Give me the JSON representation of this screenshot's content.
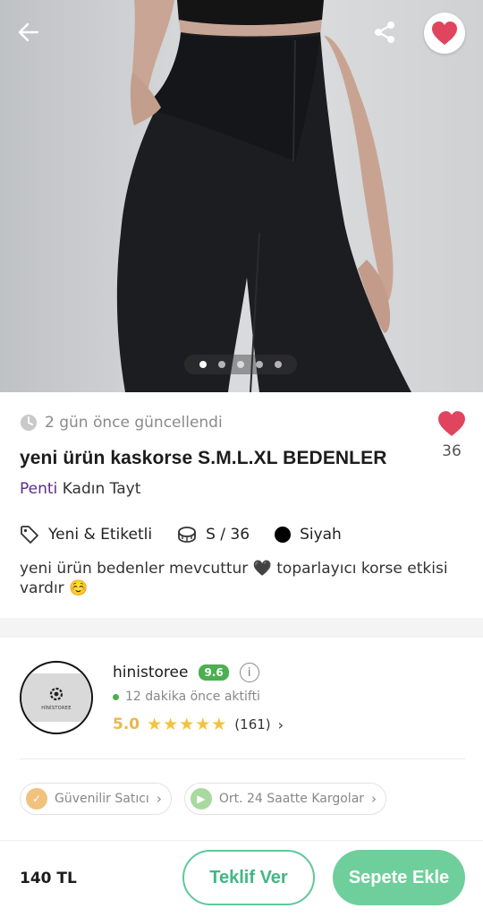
{
  "gallery": {
    "image_count": 5,
    "active_index": 0
  },
  "header": {
    "back_icon": "arrow-left-icon",
    "share_icon": "share-icon",
    "favorite_icon": "heart-icon",
    "favorite_color": "#e0445e"
  },
  "product": {
    "updated_text": "2 gün önce güncellendi",
    "likes": "36",
    "title": "yeni ürün kaskorse S.M.L.XL BEDENLER",
    "brand": "Penti",
    "category": "Kadın Tayt",
    "condition": "Yeni & Etiketli",
    "size": "S / 36",
    "color_name": "Siyah",
    "color_hex": "#000000",
    "description": "yeni ürün bedenler mevcuttur 🖤 toparlayıcı korse etkisi vardır ☺️"
  },
  "seller": {
    "name": "hinistoree",
    "score": "9.6",
    "active_text": "12 dakika önce aktifti",
    "rating": "5.0",
    "stars": 5,
    "rating_count": "(161)",
    "avatar_text": "HİNİSTOREE",
    "badges": [
      {
        "label": "Güvenilir Satıcı",
        "icon": "trusted-seller-icon"
      },
      {
        "label": "Ort. 24 Saatte Kargolar",
        "icon": "shipping-icon"
      }
    ]
  },
  "bottom_bar": {
    "price": "140 TL",
    "offer_label": "Teklif Ver",
    "cart_label": "Sepete Ekle"
  },
  "colors": {
    "accent_green": "#3fb882",
    "brand_purple": "#5b2c8a",
    "star_gold": "#f4c23d"
  }
}
